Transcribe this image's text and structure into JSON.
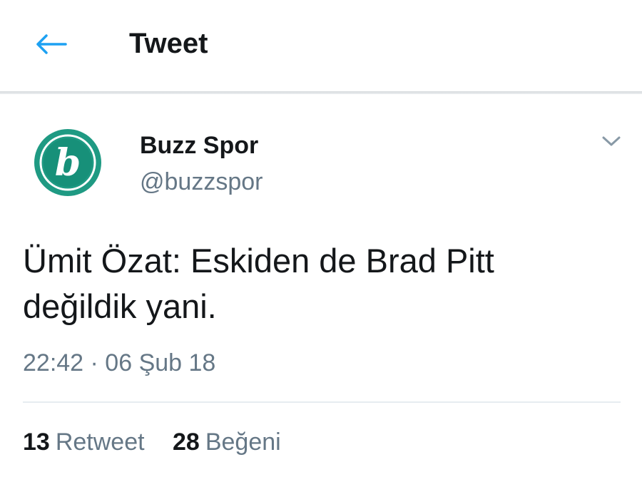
{
  "header": {
    "title": "Tweet",
    "back_icon": "arrow-left-icon"
  },
  "tweet": {
    "author": {
      "name": "Buzz Spor",
      "handle": "@buzzspor",
      "avatar_letter": "b"
    },
    "text_line1": "Ümit Özat: Eskiden de Brad Pitt",
    "text_line2": "değildik yani.",
    "timestamp": "22:42 · 06 Şub 18",
    "stats": {
      "retweets_count": "13",
      "retweets_label": "Retweet",
      "likes_count": "28",
      "likes_label": "Beğeni"
    }
  },
  "colors": {
    "accent": "#1da1f2",
    "text_primary": "#14171a",
    "text_secondary": "#657786",
    "avatar_bg": "#1f9a83"
  }
}
